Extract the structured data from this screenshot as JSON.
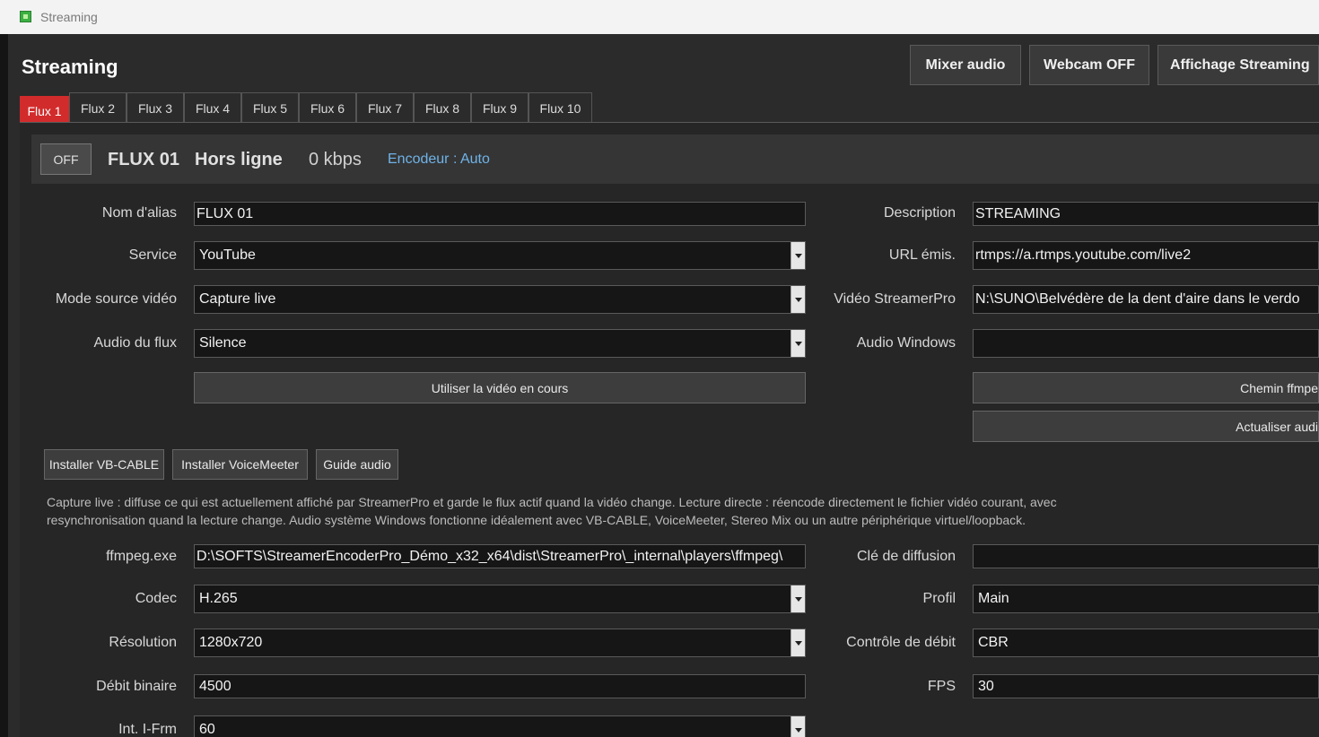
{
  "window": {
    "title": "Streaming"
  },
  "header": {
    "title": "Streaming",
    "buttons": {
      "mixer": "Mixer audio",
      "webcam": "Webcam OFF",
      "display": "Affichage Streaming"
    }
  },
  "tabs": [
    "Flux 1",
    "Flux 2",
    "Flux 3",
    "Flux 4",
    "Flux 5",
    "Flux 6",
    "Flux 7",
    "Flux 8",
    "Flux 9",
    "Flux 10"
  ],
  "status": {
    "toggle": "OFF",
    "name": "FLUX 01",
    "state": "Hors ligne",
    "bitrate": "0 kbps",
    "encoder": "Encodeur : Auto"
  },
  "left": {
    "alias": {
      "label": "Nom d'alias",
      "value": "FLUX 01"
    },
    "service": {
      "label": "Service",
      "value": "YouTube"
    },
    "source": {
      "label": "Mode source vidéo",
      "value": "Capture live"
    },
    "audio": {
      "label": "Audio du flux",
      "value": "Silence"
    },
    "use_video_button": "Utiliser la vidéo en cours",
    "ffmpeg": {
      "label": "ffmpeg.exe",
      "value": "D:\\SOFTS\\StreamerEncoderPro_Démo_x32_x64\\dist\\StreamerPro\\_internal\\players\\ffmpeg\\"
    },
    "codec": {
      "label": "Codec",
      "value": "H.265"
    },
    "resolution": {
      "label": "Résolution",
      "value": "1280x720"
    },
    "bitrate": {
      "label": "Débit binaire",
      "value": "4500"
    },
    "iframe": {
      "label": "Int. I-Frm",
      "value": "60"
    }
  },
  "right": {
    "description": {
      "label": "Description",
      "value": "STREAMING"
    },
    "url": {
      "label": "URL émis.",
      "value": "rtmps://a.rtmps.youtube.com/live2"
    },
    "video": {
      "label": "Vidéo StreamerPro",
      "value": "N:\\SUNO\\Belvédère de la dent d'aire dans le verdo"
    },
    "audio_windows": {
      "label": "Audio Windows",
      "value": ""
    },
    "ffmpeg_path_button": "Chemin ffmpe",
    "refresh_audio_button": "Actualiser audi",
    "stream_key": {
      "label": "Clé de diffusion",
      "value": ""
    },
    "profile": {
      "label": "Profil",
      "value": "Main"
    },
    "rate_control": {
      "label": "Contrôle de débit",
      "value": "CBR"
    },
    "fps": {
      "label": "FPS",
      "value": "30"
    }
  },
  "setup_buttons": {
    "vbcable": "Installer VB-CABLE",
    "voicemeeter": "Installer VoiceMeeter",
    "guide": "Guide audio"
  },
  "help": {
    "line1": "Capture live : diffuse ce qui est actuellement affiché par StreamerPro et garde le flux actif quand la vidéo change. Lecture directe : réencode directement le fichier vidéo courant, avec",
    "line2": "resynchronisation quand la lecture change. Audio système Windows fonctionne idéalement avec VB-CABLE, VoiceMeeter, Stereo Mix ou un autre périphérique virtuel/loopback."
  }
}
